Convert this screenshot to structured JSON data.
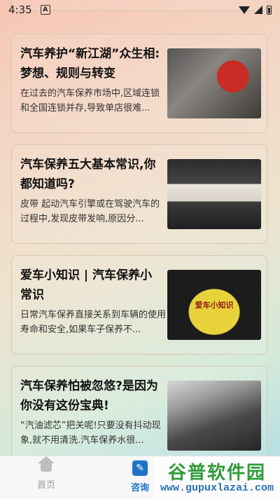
{
  "status_bar": {
    "time": "4:35",
    "notification_badge": "A"
  },
  "articles": [
    {
      "title": "汽车养护“新江湖”众生相:梦想、规则与转变",
      "desc": "在过去的汽车保养市场中,区域连锁和全国连锁并存,导致单店很难...",
      "thumb": "hand-oil-filling"
    },
    {
      "title": "汽车保养五大基本常识,你都知道吗?",
      "desc": "皮带 起动汽车引擎或在驾驶汽车的过程中,发现皮带发响,原因分...",
      "thumb": "engine-coolant-reservoir"
    },
    {
      "title": "爱车小知识 | 汽车保养小常识",
      "desc": "日常汽车保养直接关系到车辆的使用寿命和安全,如果车子保养不...",
      "thumb": "cartoon-car",
      "thumb_text": "爱车小知识"
    },
    {
      "title": "汽车保养怕被忽悠?是因为你没有这份宝典!",
      "desc": "“汽油滤芯”把关呢!只要没有抖动现象,就不用清洗.汽车保养水很...",
      "thumb": "engine-bay"
    }
  ],
  "bottom_nav": {
    "home": "首页",
    "consult": "咨询",
    "consult_icon": "✎",
    "active": "consult",
    "active_color": "#1e73c8"
  },
  "watermark": {
    "title": "谷普软件园",
    "url": "www.gupuxlazai.com"
  }
}
